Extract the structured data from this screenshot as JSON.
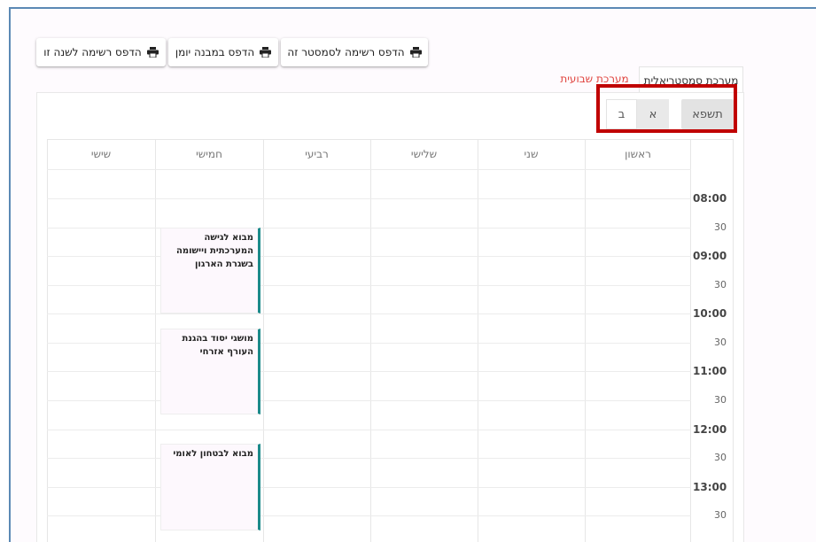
{
  "print_buttons": [
    {
      "label": "הדפס רשימה לסמסטר זה",
      "icon": "printer-icon"
    },
    {
      "label": "הדפס במבנה יומן",
      "icon": "printer-icon"
    },
    {
      "label": "הדפס רשימה לשנה זו",
      "icon": "printer-icon"
    }
  ],
  "tabs": {
    "semester": "מערכת סמסטריאלית",
    "weekly": "מערכת שבועית"
  },
  "semester_selector": {
    "year": "תשפא",
    "sem_a": "א",
    "sem_b": "ב"
  },
  "days": [
    "ראשון",
    "שני",
    "שלישי",
    "רביעי",
    "חמישי",
    "שישי"
  ],
  "times": [
    "08:00",
    "30",
    "09:00",
    "30",
    "10:00",
    "30",
    "11:00",
    "30",
    "12:00",
    "30",
    "13:00",
    "30"
  ],
  "events": [
    {
      "title": "מבוא לגישה המערכתית ויישומה בשגרת הארגון"
    },
    {
      "title": "מושגי יסוד בהגנת העורף אזרחי"
    },
    {
      "title": "מבוא לבטחון לאומי"
    }
  ],
  "colors": {
    "accent_teal": "#1c8a8a",
    "weekly_tab_red": "#e0443f",
    "highlight_red": "#c00000"
  }
}
